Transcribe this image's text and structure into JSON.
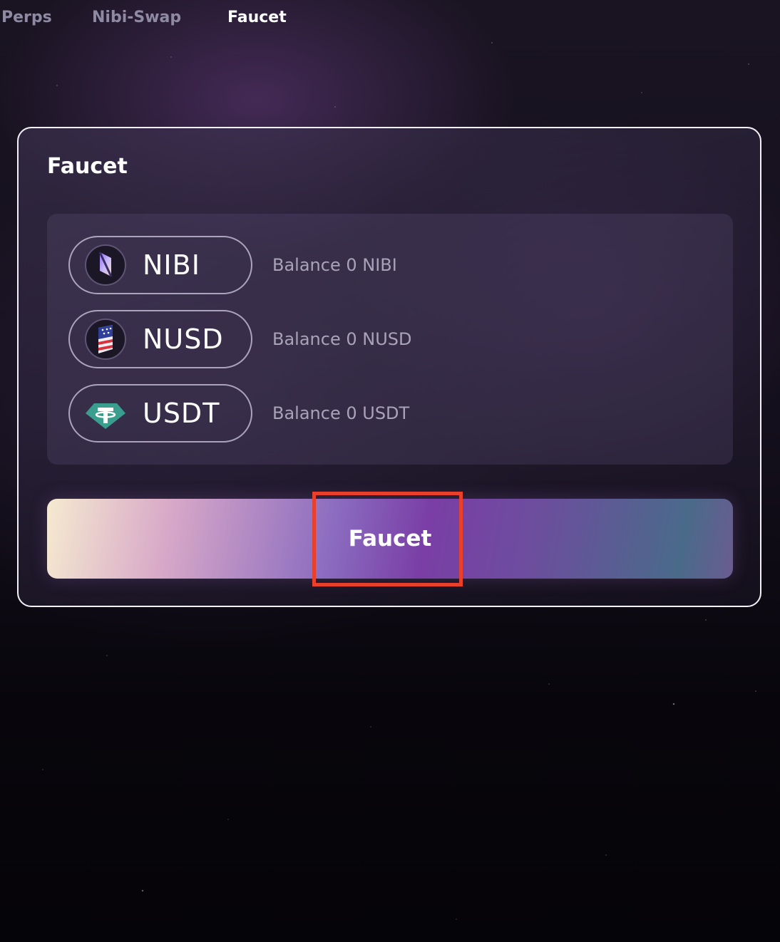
{
  "nav": {
    "items": [
      {
        "label": "Perps",
        "active": false
      },
      {
        "label": "Nibi-Swap",
        "active": false
      },
      {
        "label": "Faucet",
        "active": true
      }
    ]
  },
  "card": {
    "title": "Faucet",
    "tokens": [
      {
        "symbol": "NIBI",
        "balance_text": "Balance 0 NIBI",
        "icon": "nibi-icon"
      },
      {
        "symbol": "NUSD",
        "balance_text": "Balance 0 NUSD",
        "icon": "nusd-icon"
      },
      {
        "symbol": "USDT",
        "balance_text": "Balance 0 USDT",
        "icon": "usdt-icon"
      }
    ],
    "button_label": "Faucet"
  },
  "colors": {
    "highlight": "#e8402b",
    "usdt_teal": "#3a9e8e",
    "nav_inactive": "#8e8aa4",
    "balance_text": "#a8a3b8"
  }
}
